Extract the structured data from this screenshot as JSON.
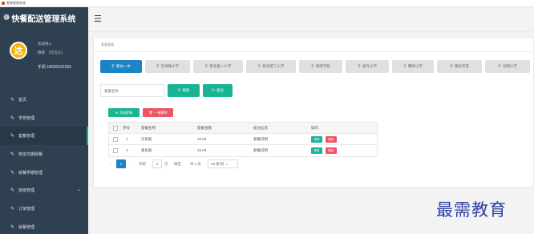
{
  "window": {
    "title": "套餐管理系统"
  },
  "brand": {
    "icon": "paw-icon",
    "title": "快餐配送管理系统"
  },
  "profile": {
    "avatar_glyph": "达",
    "welcome": "欢迎进入",
    "name": "静雷",
    "role": "【管理员】",
    "phone": "手机:18650331555"
  },
  "sidebar": {
    "items": [
      {
        "label": "首页",
        "icon": "edit-icon"
      },
      {
        "label": "学校管理",
        "icon": "edit-icon"
      },
      {
        "label": "套餐管理",
        "icon": "edit-icon",
        "active": true
      },
      {
        "label": "特定日期就餐",
        "icon": "edit-icon"
      },
      {
        "label": "就餐学期管理",
        "icon": "edit-icon"
      },
      {
        "label": "班级管理",
        "icon": "edit-icon",
        "has_children": true
      },
      {
        "label": "订单管理",
        "icon": "edit-icon"
      },
      {
        "label": "就餐管理",
        "icon": "edit-icon"
      }
    ]
  },
  "topbar": {
    "menu_icon": "hamburger-icon"
  },
  "panel": {
    "title": "套餐管理"
  },
  "tabs": [
    {
      "label": "新站一中",
      "active": true
    },
    {
      "label": "岱洋镇小学"
    },
    {
      "label": "新北第一小学"
    },
    {
      "label": "新北第二小学"
    },
    {
      "label": "阳阳学校"
    },
    {
      "label": "复元小学"
    },
    {
      "label": "朝阳小学"
    },
    {
      "label": "建好阿克"
    },
    {
      "label": "光明小学"
    }
  ],
  "search": {
    "placeholder": "套餐名称",
    "search_label": "搜索",
    "reset_label": "复位"
  },
  "actions": {
    "add_label": "添加套餐",
    "batch_delete_label": "一键删除"
  },
  "table": {
    "columns": [
      "序号",
      "套餐名称",
      "套餐金额",
      "备注信息",
      "操作"
    ],
    "rows": [
      {
        "index": "1",
        "name": "汉民般",
        "amount": "15.00",
        "note": "套餐说明"
      },
      {
        "index": "2",
        "name": "素民般",
        "amount": "15.00",
        "note": "套餐说明"
      }
    ],
    "edit_label": "修改",
    "delete_label": "删除"
  },
  "pagination": {
    "prev": "‹",
    "current_page": "1",
    "next": "›",
    "goto_label": "到第",
    "goto_value": "1",
    "page_unit": "页",
    "confirm_label": "确定",
    "total_label": "共 2 条",
    "page_size_label": "10 条/页"
  },
  "watermark": "最需教育"
}
